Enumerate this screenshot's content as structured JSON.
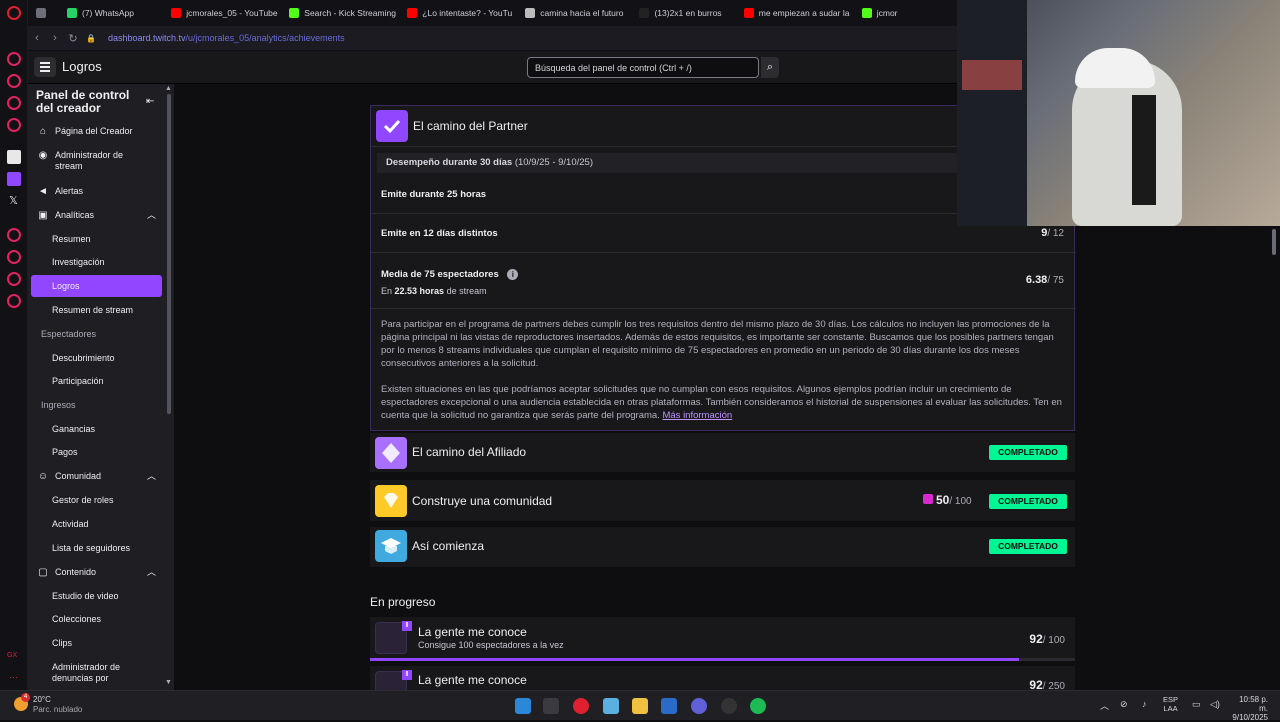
{
  "browser": {
    "tabs": [
      {
        "label": "",
        "color": "#6e6e78"
      },
      {
        "label": "(7) WhatsApp",
        "color": "#25d366"
      },
      {
        "label": "jcmorales_05 - YouTube",
        "color": "#ff0000"
      },
      {
        "label": "Search - Kick Streaming",
        "color": "#53fc18"
      },
      {
        "label": "¿Lo intentaste? - YouTu",
        "color": "#ff0000"
      },
      {
        "label": "camina hacia el futuro",
        "color": "#bbbbbb"
      },
      {
        "label": "(13)2x1 en burros",
        "color": "#222222"
      },
      {
        "label": "me empiezan a sudar la",
        "color": "#ff0000"
      },
      {
        "label": "jcmor",
        "color": "#53fc18"
      }
    ],
    "url_host": "dashboard.twitch.tv",
    "url_path": "/u/jcmorales_05/analytics/achievements"
  },
  "topbar": {
    "title": "Logros",
    "search_placeholder": "Búsqueda del panel de control (Ctrl + /)"
  },
  "sidebar": {
    "heading": "Panel de control del creador",
    "items": [
      {
        "label": "Página del Creador",
        "icon": "home-icon"
      },
      {
        "label": "Administrador de stream",
        "icon": "broadcast-icon"
      },
      {
        "label": "Alertas",
        "icon": "megaphone-icon"
      },
      {
        "label": "Analíticas",
        "icon": "analytics-icon"
      },
      {
        "label": "Resumen"
      },
      {
        "label": "Investigación"
      },
      {
        "label": "Logros"
      },
      {
        "label": "Resumen de stream"
      },
      {
        "label": "Espectadores"
      },
      {
        "label": "Descubrimiento"
      },
      {
        "label": "Participación"
      },
      {
        "label": "Ingresos"
      },
      {
        "label": "Ganancias"
      },
      {
        "label": "Pagos"
      },
      {
        "label": "Comunidad",
        "icon": "community-icon"
      },
      {
        "label": "Gestor de roles"
      },
      {
        "label": "Actividad"
      },
      {
        "label": "Lista de seguidores"
      },
      {
        "label": "Contenido",
        "icon": "content-icon"
      },
      {
        "label": "Estudio de video"
      },
      {
        "label": "Colecciones"
      },
      {
        "label": "Clips"
      },
      {
        "label": "Administrador de denuncias por"
      }
    ]
  },
  "partner": {
    "title": "El camino del Partner",
    "perf_label": "Desempeño durante 30 días",
    "perf_range": "(10/9/25 - 9/10/25)",
    "req1": "Emite durante 25 horas",
    "req2": "Emite en 12 días distintos",
    "req2_value": "9",
    "req2_total": "/ 12",
    "req3": "Media de 75 espectadores",
    "req3_sub_pre": "En",
    "req3_sub_hours": "22.53 horas",
    "req3_sub_post": "de stream",
    "req3_value": "6.38",
    "req3_total": "/ 75",
    "para1": "Para participar en el programa de partners debes cumplir los tres requisitos dentro del mismo plazo de 30 días. Los cálculos no incluyen las promociones de la página principal ni las vistas de reproductores insertados. Además de estos requisitos, es importante ser constante. Buscamos que los posibles partners tengan por lo menos 8 streams individuales que cumplan el requisito mínimo de 75 espectadores en promedio en un periodo de 30 días durante los dos meses consecutivos anteriores a la solicitud.",
    "para2": "Existen situaciones en las que podríamos aceptar solicitudes que no cumplan con esos requisitos. Algunos ejemplos podrían incluir un crecimiento de espectadores excepcional o una audiencia establecida en otras plataformas. También consideramos el historial de suspensiones al evaluar las solicitudes. Ten en cuenta que la solicitud no garantiza que serás parte del programa.",
    "more_link": "Más información"
  },
  "completed": [
    {
      "title": "El camino del Afiliado",
      "status": "COMPLETADO",
      "color": "#a970ff"
    },
    {
      "title": "Construye una comunidad",
      "status": "COMPLETADO",
      "count": "50",
      "total": "/ 100",
      "color": "#ffca28"
    },
    {
      "title": "Así comienza",
      "status": "COMPLETADO",
      "color": "#3fa9e0"
    }
  ],
  "in_progress_title": "En progreso",
  "in_progress": [
    {
      "title": "La gente me conoce",
      "subtitle": "Consigue 100 espectadores a la vez",
      "value": "92",
      "total": "/ 100",
      "progress": 0.92
    },
    {
      "title": "La gente me conoce",
      "value": "92",
      "total": "/ 250",
      "progress": 0.368
    }
  ],
  "taskbar": {
    "weather_temp": "20°C",
    "weather_desc": "Parc. nublado",
    "weather_badge": "4",
    "lang": "ESP",
    "lang_sub": "LAA",
    "time": "10:58 p. m.",
    "date": "9/10/2025"
  },
  "colors": {
    "accent": "#9147ff",
    "completed": "#00f593"
  }
}
